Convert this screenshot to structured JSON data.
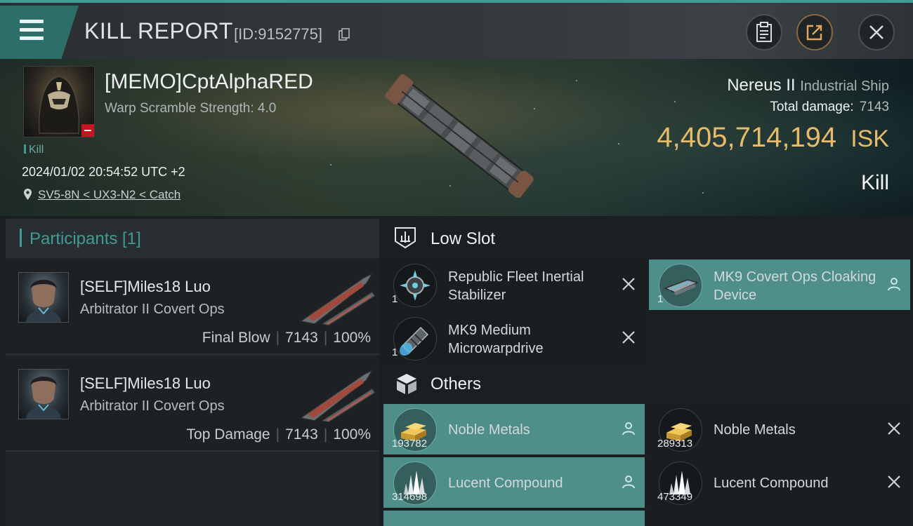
{
  "header": {
    "title": "KILL REPORT",
    "kill_id": "[ID:9152775]",
    "icons": [
      "menu-icon",
      "copy-icon",
      "clipboard-icon",
      "share-icon",
      "close-icon"
    ]
  },
  "victim": {
    "name": "[MEMO]CptAlphaRED",
    "warp_scramble": "Warp Scramble Strength: 4.0",
    "kill_tag": "Kill",
    "datetime": "2024/01/02 20:54:52 UTC +2",
    "location": "SV5-8N < UX3-N2 < Catch",
    "ship": "Nereus II",
    "ship_class": "Industrial Ship",
    "total_damage_label": "Total damage:",
    "total_damage": "7143",
    "isk_value": "4,405,714,194",
    "isk_unit": "ISK",
    "result": "Kill"
  },
  "participants": {
    "header": "Participants [1]",
    "items": [
      {
        "name": "[SELF]Miles18 Luo",
        "ship": "Arbitrator II Covert Ops",
        "role": "Final Blow",
        "damage": "7143",
        "percent": "100%"
      },
      {
        "name": "[SELF]Miles18 Luo",
        "ship": "Arbitrator II Covert Ops",
        "role": "Top Damage",
        "damage": "7143",
        "percent": "100%"
      }
    ]
  },
  "low_slot": {
    "title": "Low Slot",
    "items": [
      {
        "name": "Republic Fleet Inertial Stabilizer",
        "qty": "1",
        "status": "destroyed"
      },
      {
        "name": "MK9 Covert Ops Cloaking Device",
        "qty": "1",
        "status": "dropped"
      },
      {
        "name": "MK9 Medium Microwarpdrive",
        "qty": "1",
        "status": "destroyed"
      }
    ]
  },
  "others": {
    "title": "Others",
    "items": [
      {
        "name": "Noble Metals",
        "qty": "193782",
        "status": "dropped"
      },
      {
        "name": "Noble Metals",
        "qty": "289313",
        "status": "destroyed"
      },
      {
        "name": "Lucent Compound",
        "qty": "314698",
        "status": "dropped"
      },
      {
        "name": "Lucent Compound",
        "qty": "473349",
        "status": "destroyed"
      }
    ]
  },
  "colors": {
    "accent": "#3e9c93",
    "isk": "#e6bb6a",
    "highlight": "#4e8f8a",
    "loss_badge": "#c4161c"
  }
}
